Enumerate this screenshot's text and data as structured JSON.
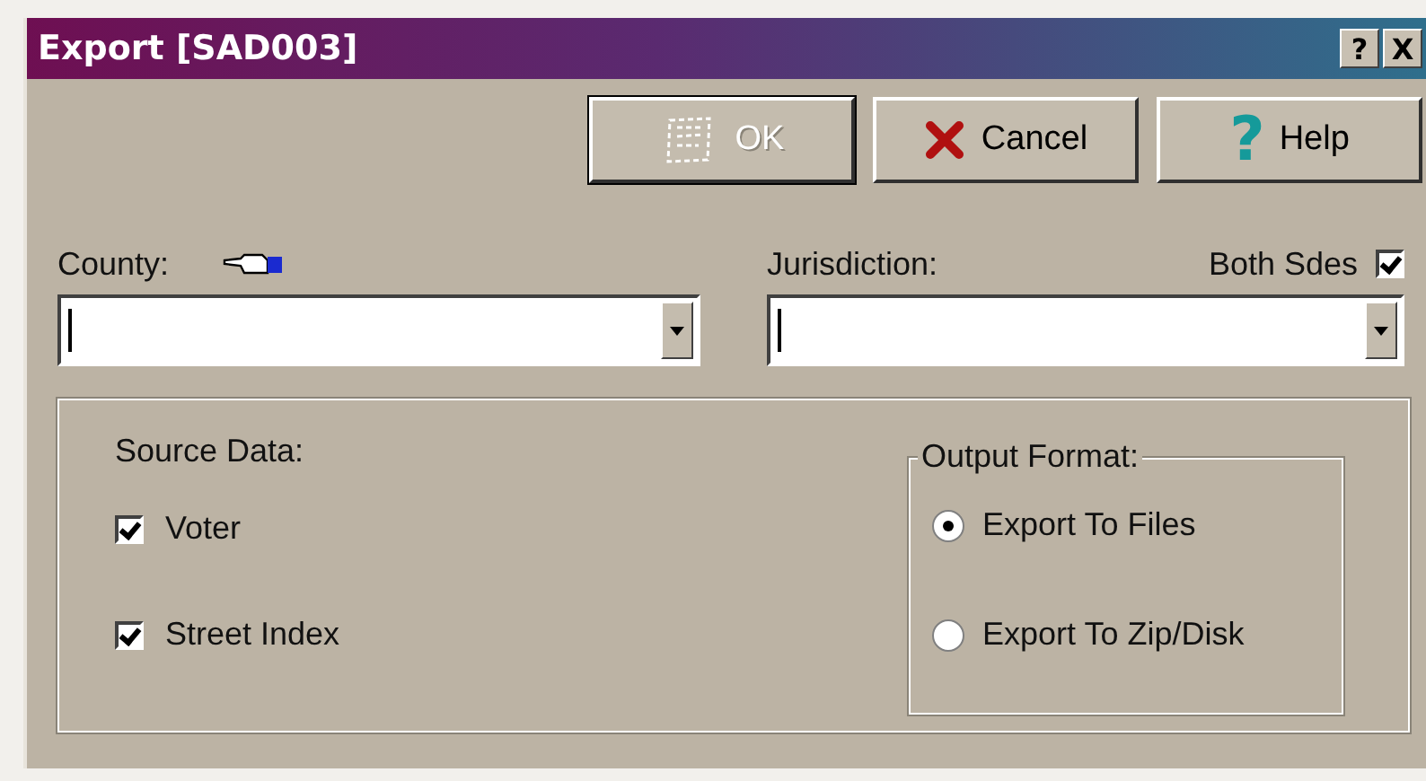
{
  "window": {
    "title": "Export [SAD003]",
    "title_buttons": [
      {
        "label": "?"
      },
      {
        "label": "X"
      }
    ]
  },
  "buttons": [
    {
      "kind": "ok",
      "label": "OK",
      "disabled": true
    },
    {
      "kind": "cancel",
      "label": "Cancel",
      "disabled": false
    },
    {
      "kind": "help",
      "label": "Help",
      "icon": "?",
      "disabled": false
    }
  ],
  "county": {
    "label": "County:"
  },
  "jurisdiction": {
    "label": "Jurisdiction:",
    "both_sides": {
      "label": "Both Sdes",
      "checked": true
    }
  },
  "source_data": {
    "label": "Source Data:",
    "options": [
      {
        "label": "Voter",
        "checked": true
      },
      {
        "label": "Street Index",
        "checked": true
      }
    ]
  },
  "output_format": {
    "label": "Output Format:",
    "options": [
      {
        "label": "Export To Files",
        "selected": true
      },
      {
        "label": "Export To Zip/Disk",
        "selected": false
      }
    ]
  }
}
